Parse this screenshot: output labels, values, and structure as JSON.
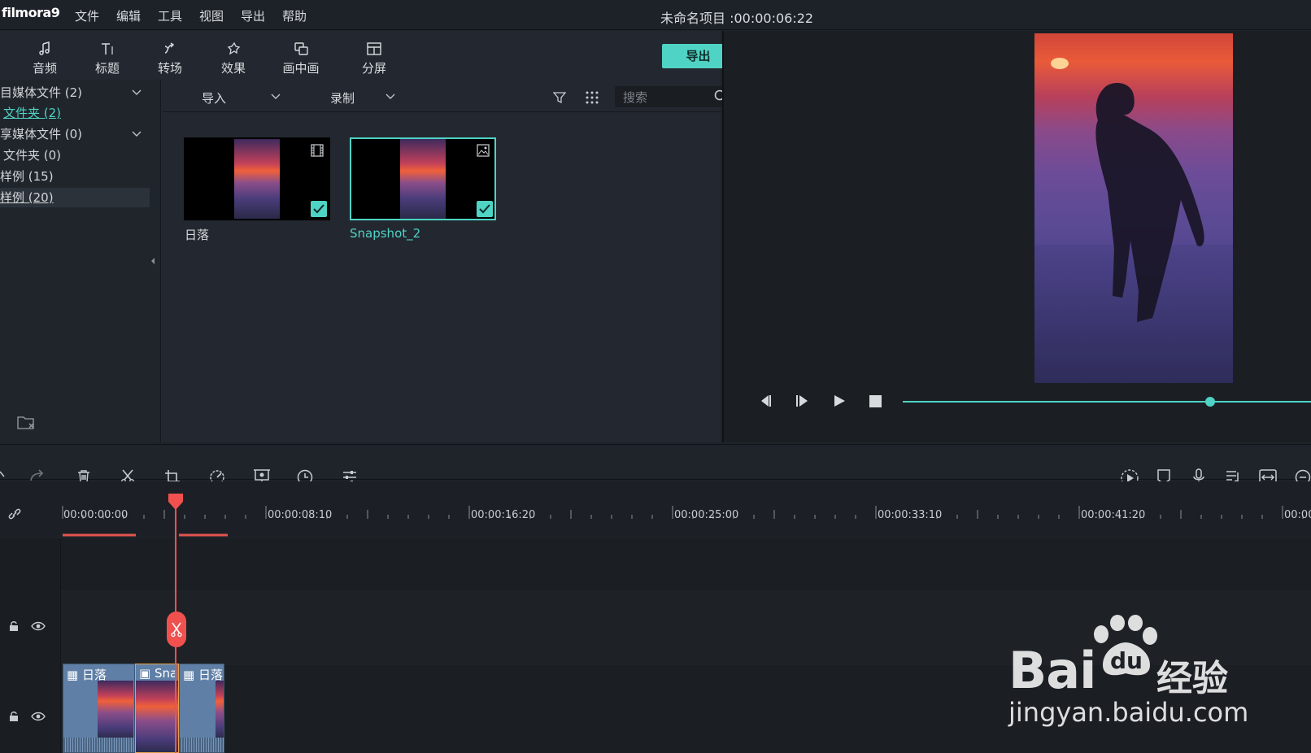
{
  "app": {
    "logo": "filmora9",
    "project_title": "未命名项目 :00:00:06:22"
  },
  "menu": [
    "文件",
    "编辑",
    "工具",
    "视图",
    "导出",
    "帮助"
  ],
  "toolbar_tabs": [
    {
      "label": "音频",
      "icon": "music-icon"
    },
    {
      "label": "标题",
      "icon": "title-icon"
    },
    {
      "label": "转场",
      "icon": "transition-icon"
    },
    {
      "label": "效果",
      "icon": "effects-icon"
    },
    {
      "label": "画中画",
      "icon": "pip-icon"
    },
    {
      "label": "分屏",
      "icon": "splitscreen-icon"
    }
  ],
  "export_label": "导出",
  "sidebar": {
    "items": [
      {
        "label": "目媒体文件 (2)"
      },
      {
        "label": "文件夹 (2)"
      },
      {
        "label": "享媒体文件 (0)"
      },
      {
        "label": "文件夹 (0)"
      },
      {
        "label": "样例 (15)"
      },
      {
        "label": "样例 (20)"
      }
    ]
  },
  "media_toolbar": {
    "import_label": "导入",
    "record_label": "录制",
    "search_placeholder": "搜索"
  },
  "media_items": [
    {
      "name": "日落",
      "type": "video",
      "icon": "film-icon"
    },
    {
      "name": "Snapshot_2",
      "type": "image",
      "icon": "image-icon"
    }
  ],
  "timeline": {
    "timecodes": [
      "00:00:00:00",
      "00:00:08:10",
      "00:00:16:20",
      "00:00:25:00",
      "00:00:33:10",
      "00:00:41:20",
      "00:00"
    ],
    "clips": [
      {
        "label": "日落"
      },
      {
        "label": "Sna"
      },
      {
        "label": "日落"
      }
    ]
  },
  "watermark": {
    "brand": "Bai du",
    "cn": "经验",
    "url": "jingyan.baidu.com"
  },
  "colors": {
    "accent": "#4fd3c4",
    "playhead": "#f0514f"
  }
}
